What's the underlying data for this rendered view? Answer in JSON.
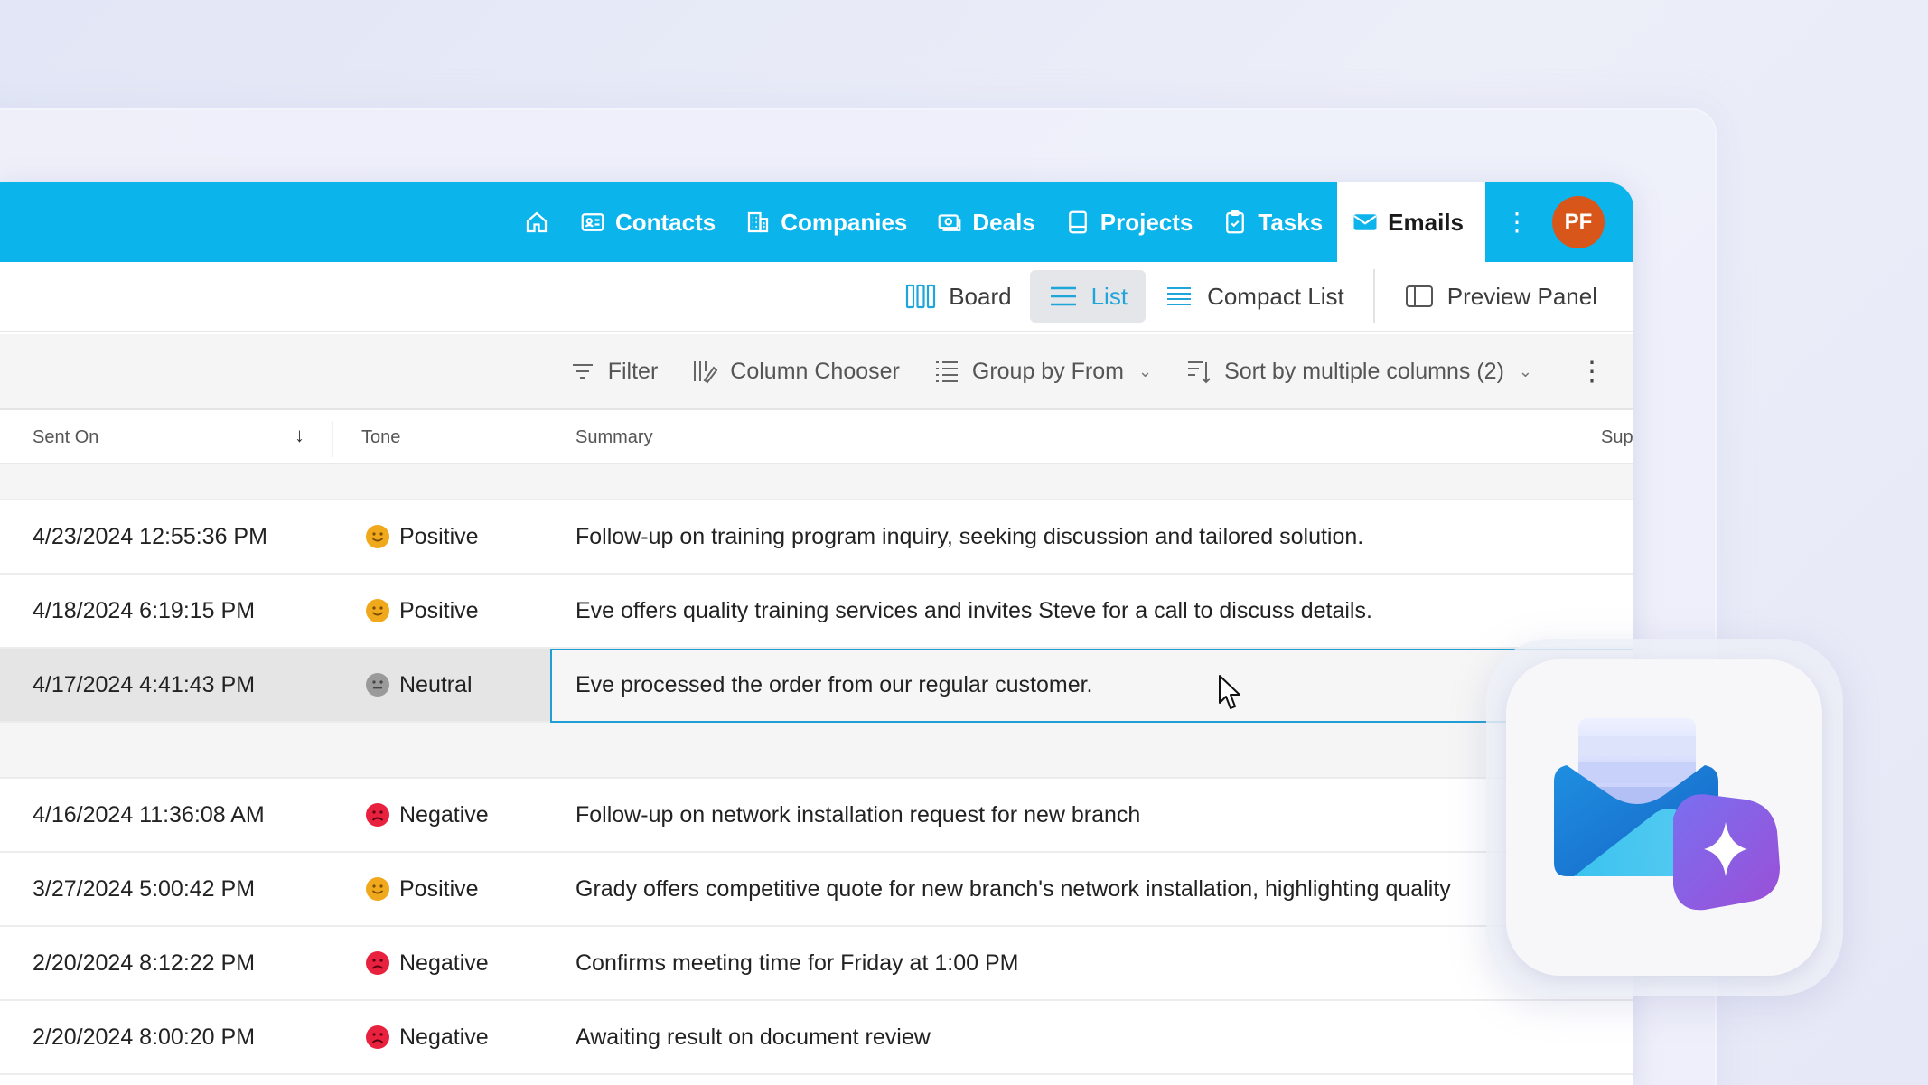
{
  "nav": {
    "items": [
      {
        "label": "",
        "icon": "home-icon"
      },
      {
        "label": "Contacts",
        "icon": "contact-card-icon"
      },
      {
        "label": "Companies",
        "icon": "building-icon"
      },
      {
        "label": "Deals",
        "icon": "money-icon"
      },
      {
        "label": "Projects",
        "icon": "clipboard-icon"
      },
      {
        "label": "Tasks",
        "icon": "task-check-icon"
      },
      {
        "label": "Emails",
        "icon": "mail-icon",
        "active": true
      }
    ],
    "more": "⋮",
    "avatar_initials": "PF"
  },
  "views": {
    "board": "Board",
    "list": "List",
    "compact_list": "Compact List",
    "preview_panel": "Preview Panel"
  },
  "toolbar": {
    "filter": "Filter",
    "column_chooser": "Column Chooser",
    "group_by": "Group by From",
    "sort": "Sort by multiple columns (2)",
    "more": "⋮"
  },
  "columns": {
    "sent_on": "Sent On",
    "tone": "Tone",
    "summary": "Summary",
    "sup": "Sup"
  },
  "rows": [
    {
      "sent_on": "4/23/2024 12:55:36 PM",
      "tone": "Positive",
      "summary": "Follow-up on training program inquiry, seeking discussion and tailored solution."
    },
    {
      "sent_on": "4/18/2024 6:19:15 PM",
      "tone": "Positive",
      "summary": "Eve offers quality training services and invites Steve for a call to discuss details."
    },
    {
      "sent_on": "4/17/2024 4:41:43 PM",
      "tone": "Neutral",
      "summary": "Eve processed the order from our regular customer.",
      "selected": true
    },
    {
      "sent_on": "4/16/2024 11:36:08 AM",
      "tone": "Negative",
      "summary": "Follow-up on network installation request for new branch"
    },
    {
      "sent_on": "3/27/2024 5:00:42 PM",
      "tone": "Positive",
      "summary": "Grady offers competitive quote for new branch's network installation, highlighting quality"
    },
    {
      "sent_on": "2/20/2024 8:12:22 PM",
      "tone": "Negative",
      "summary": "Confirms meeting time for Friday at 1:00 PM"
    },
    {
      "sent_on": "2/20/2024 8:00:20 PM",
      "tone": "Negative",
      "summary": "Awaiting result on document review"
    }
  ],
  "colors": {
    "nav_bg": "#0cb4ec",
    "accent": "#1fa5d9",
    "positive": "#f0a81c",
    "neutral": "#9a9a9a",
    "negative": "#e8213f",
    "avatar": "#d8561a"
  }
}
